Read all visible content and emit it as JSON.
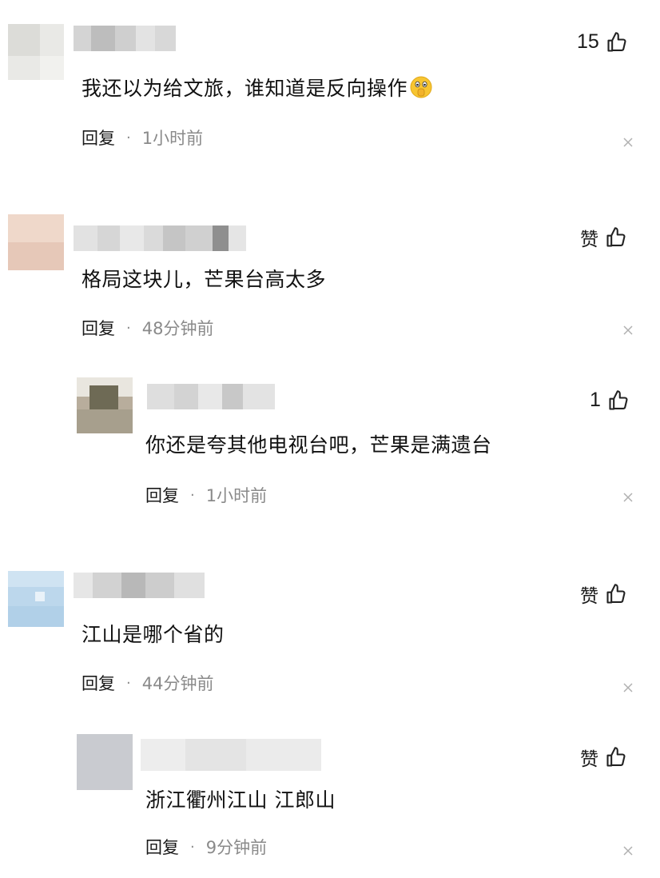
{
  "comments": [
    {
      "text": "我还以为给文旅，谁知道是反向操作",
      "emoji": "shushing-face",
      "like": "15",
      "reply": "回复",
      "dot": "·",
      "time": "1小时前"
    },
    {
      "text": "格局这块儿，芒果台高太多",
      "like": "赞",
      "reply": "回复",
      "dot": "·",
      "time": "48分钟前"
    },
    {
      "text": "你还是夸其他电视台吧，芒果是满遗台",
      "like": "1",
      "reply": "回复",
      "dot": "·",
      "time": "1小时前"
    },
    {
      "text": "江山是哪个省的",
      "like": "赞",
      "reply": "回复",
      "dot": "·",
      "time": "44分钟前"
    },
    {
      "text": "浙江衢州江山 江郎山",
      "like": "赞",
      "reply": "回复",
      "dot": "·",
      "time": "9分钟前"
    }
  ],
  "icons": {
    "like": "thumbs-up-icon",
    "dismiss": "close-icon",
    "emoji": "shushing-face-emoji"
  },
  "colors": {
    "text": "#111111",
    "secondary": "#8a8a8a",
    "background": "#ffffff"
  }
}
